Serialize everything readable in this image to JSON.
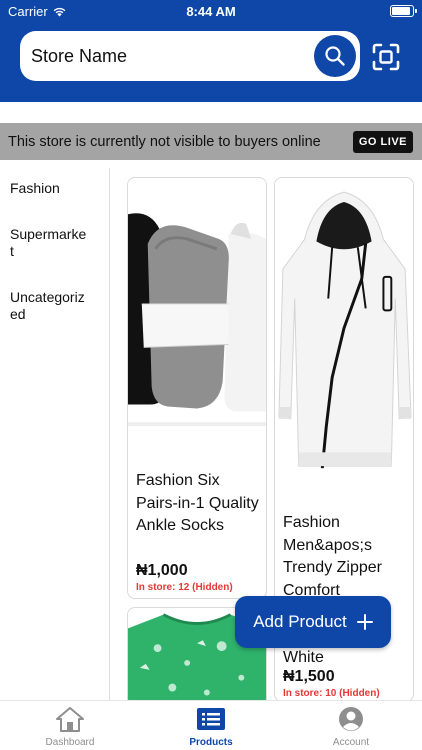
{
  "status_bar": {
    "carrier": "Carrier",
    "time": "8:44 AM"
  },
  "header": {
    "search_value": "Store Name"
  },
  "notice": {
    "text": "This store is currently not visible to buyers online",
    "action": "GO LIVE"
  },
  "categories": [
    "Fashion",
    "Supermarket",
    "Uncategorized"
  ],
  "products": [
    {
      "title": "Fashion Six Pairs-in-1 Quality Ankle Socks",
      "price": "₦1,000",
      "stock": "In store: 12 (Hidden)"
    },
    {
      "title": "Fashion Men&apos;s Trendy Zipper Comfort Hoodie Jacket - White",
      "title_visible_top": "Fashion Men&apos;s Trendy Zipper Comfort",
      "title_visible_bottom": "White",
      "price": "₦1,500",
      "stock": "In store: 10 (Hidden)"
    }
  ],
  "fab": {
    "label": "Add Product"
  },
  "tabs": [
    {
      "label": "Dashboard",
      "icon": "home-icon"
    },
    {
      "label": "Products",
      "icon": "list-icon"
    },
    {
      "label": "Account",
      "icon": "account-icon"
    }
  ],
  "colors": {
    "brand": "#0f47a9",
    "tab_active": "#0f47a9",
    "tab_inactive": "#8e8e8e",
    "stock_hidden": "#e53935",
    "notice_bg": "#a4a4a4"
  }
}
